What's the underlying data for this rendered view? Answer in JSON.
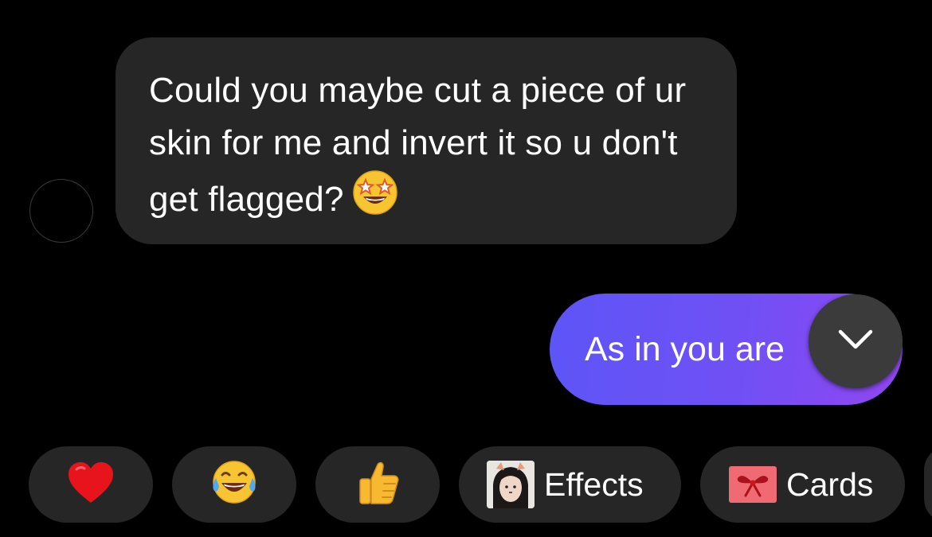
{
  "conversation": {
    "incoming_message": {
      "text": "Could you maybe cut a piece of ur skin for me and invert it so u don't get flagged?",
      "emoji": "star-struck-emoji"
    },
    "outgoing_message": {
      "text": "As in you are",
      "gradient_start": "#5d55f7",
      "gradient_end": "#9146f1"
    },
    "scroll_down": {
      "icon": "chevron-down-icon"
    }
  },
  "quick_actions": {
    "reactions": [
      {
        "icon": "red-heart-emoji"
      },
      {
        "icon": "tears-of-joy-emoji"
      },
      {
        "icon": "thumbs-up-emoji"
      }
    ],
    "effects": {
      "label": "Effects",
      "icon": "effects-thumbnail"
    },
    "cards": {
      "label": "Cards",
      "icon": "gift-bow-card-icon"
    }
  },
  "colors": {
    "background": "#000000",
    "incoming_bubble": "#262626",
    "pill_background": "#262626",
    "scroll_button": "#3b3b3b"
  }
}
